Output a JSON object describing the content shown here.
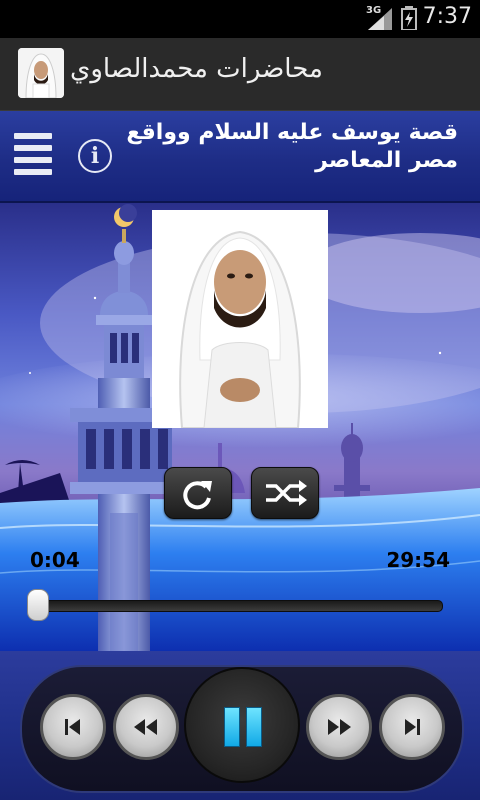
{
  "status_bar": {
    "network": "3G",
    "time": "7:37"
  },
  "action_bar": {
    "title": "محاضرات محمدالصاوي"
  },
  "header": {
    "track_title": "قصة يوسف عليه السلام وواقع مصر المعاصر",
    "info_glyph": "i"
  },
  "player": {
    "current_time": "0:04",
    "total_time": "29:54",
    "progress": 0.002,
    "state": "playing"
  },
  "colors": {
    "progress_fill": "#3d8be0",
    "play_accent": "#2fc2f5",
    "header_bg": "#233591"
  },
  "icons": {
    "menu": "hamburger-icon",
    "info": "info-icon",
    "repeat": "repeat-icon",
    "shuffle": "shuffle-icon",
    "prev": "skip-previous-icon",
    "rewind": "rewind-icon",
    "pause": "pause-icon",
    "forward": "fast-forward-icon",
    "next": "skip-next-icon"
  }
}
